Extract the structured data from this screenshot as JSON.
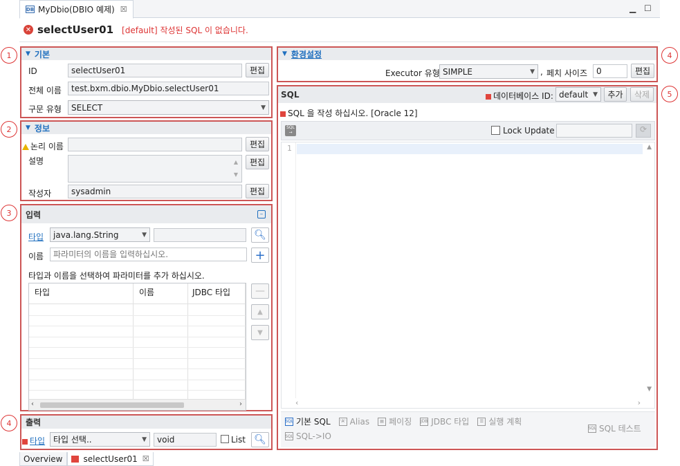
{
  "editor_tab": {
    "icon": "db-icon",
    "label": "MyDbio(DBIO 예제)",
    "close": "☒"
  },
  "header": {
    "title": "selectUser01",
    "message": "[default] 작성된 SQL 이 없습니다."
  },
  "badges": [
    "1",
    "2",
    "3",
    "4",
    "5",
    "4"
  ],
  "basic": {
    "title": "기본",
    "id_label": "ID",
    "id_value": "selectUser01",
    "edit": "편집",
    "fullname_label": "전체 이름",
    "fullname_value": "test.bxm.dbio.MyDbio.selectUser01",
    "stmt_label": "구문 유형",
    "stmt_value": "SELECT"
  },
  "info": {
    "title": "정보",
    "logical_label": "논리 이름",
    "logical_value": "",
    "edit": "편집",
    "desc_label": "설명",
    "desc_value": "",
    "author_label": "작성자",
    "author_value": "sysadmin"
  },
  "input": {
    "title": "입력",
    "type_link": "타입",
    "type_value": "java.lang.String",
    "type_extra": "",
    "name_label": "이름",
    "name_placeholder": "파라미터의 이름을 입력하십시오.",
    "hint": "타입과 이름을 선택하여 파라미터를 추가 하십시오.",
    "columns": [
      "타입",
      "이름",
      "JDBC 타입"
    ]
  },
  "output": {
    "title": "출력",
    "type_link": "타입",
    "type_value": "타입 선택..",
    "result_value": "void",
    "list_label": "List"
  },
  "env": {
    "title": "환경설정",
    "executor_label": "Executor 유형",
    "executor_value": "SIMPLE",
    "comma": ",",
    "fetch_label": "페치 사이즈",
    "fetch_value": "0",
    "edit": "편집"
  },
  "sql": {
    "title": "SQL",
    "db_label": "데이터베이스 ID:",
    "db_value": "default",
    "add": "추가",
    "delete": "삭제",
    "message": "SQL 을 작성 하십시오. [Oracle 12]",
    "lock_label": "Lock Update",
    "line_number": "1",
    "tabs": [
      "기본 SQL",
      "Alias",
      "페이징",
      "JDBC 타입",
      "실행 계획",
      "SQL->IO"
    ],
    "tab_icons": [
      "sql-icon",
      "alias-icon",
      "paging-icon",
      "jdbc-icon",
      "plan-icon",
      "sqlio-icon"
    ],
    "test": "SQL 테스트"
  },
  "bottom_tabs": [
    "Overview",
    "selectUser01"
  ],
  "colors": {
    "accent": "#1f6fbf",
    "error": "#dd3333",
    "highlight_border": "#cc5555"
  }
}
